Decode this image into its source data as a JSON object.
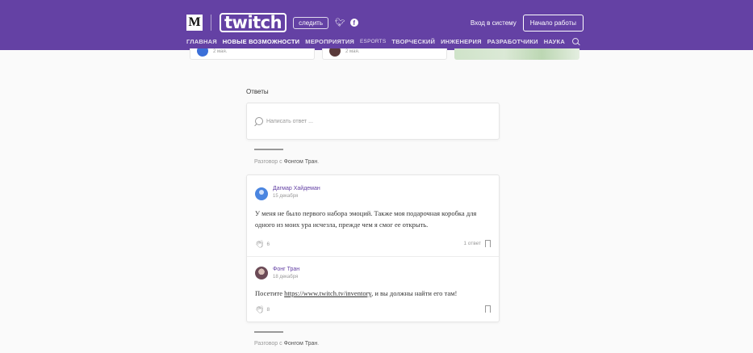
{
  "header": {
    "brand_letter": "M",
    "logo_text": "twitch",
    "follow_label": "следить",
    "twitter_icon": "twitter-icon",
    "facebook_icon": "facebook-icon",
    "login_label": "Вход в систему",
    "start_label": "Начало работы",
    "background_color": "#6441a4"
  },
  "nav": {
    "items": [
      {
        "label": "ГЛАВНАЯ"
      },
      {
        "label": "НОВЫЕ ВОЗМОЖНОСТИ"
      },
      {
        "label": "МЕРОПРИЯТИЯ"
      },
      {
        "label": "ESPORTS"
      },
      {
        "label": "ТВОРЧЕСКИЙ"
      },
      {
        "label": "ИНЖЕНЕРИЯ"
      },
      {
        "label": "РАЗРАБОТЧИКИ"
      },
      {
        "label": "НАУКА"
      }
    ],
    "search_icon": "search-icon"
  },
  "related": {
    "card1_date": "2 мая.",
    "card2_date": "2 мая."
  },
  "responses": {
    "title": "Ответы",
    "reply_placeholder": "Написать ответ ...",
    "conversation_prefix": "Разговор с",
    "conversation_name": "Фонгом Тран",
    "conversation_suffix": "."
  },
  "comments": [
    {
      "author": "Дагмар Хайдеман",
      "date": "15 декабря",
      "text": "У меня не было первого набора эмоций. Также моя подарочная коробка для одного из моих ура исчезла, прежде чем я смог ее открыть.",
      "claps": "6",
      "responses": "1 ответ"
    },
    {
      "author": "Фонг Тран",
      "date": "18 декабря",
      "text_prefix": "Посетите ",
      "link": "https://www.twitch.tv/inventory",
      "text_suffix": ", и вы должны найти его там!",
      "claps": "8"
    }
  ]
}
